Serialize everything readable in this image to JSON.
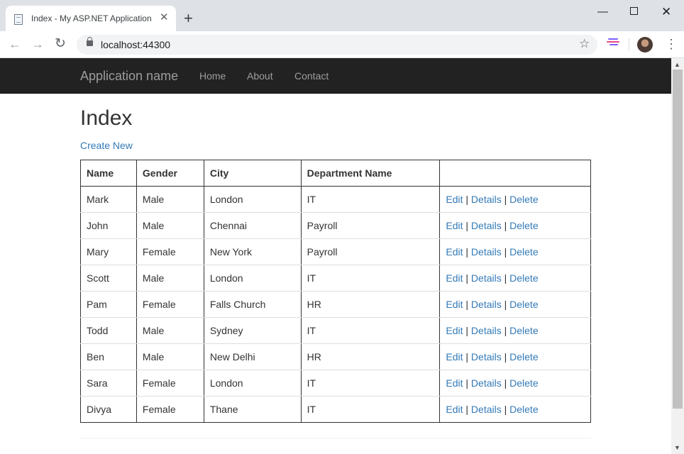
{
  "browser": {
    "tab_title": "Index - My ASP.NET Application",
    "url": "localhost:44300"
  },
  "site": {
    "brand": "Application name",
    "nav": {
      "home": "Home",
      "about": "About",
      "contact": "Contact"
    }
  },
  "page": {
    "title": "Index",
    "create_new": "Create New"
  },
  "table": {
    "headers": {
      "name": "Name",
      "gender": "Gender",
      "city": "City",
      "department": "Department Name"
    },
    "actions": {
      "edit": "Edit",
      "details": "Details",
      "delete": "Delete",
      "separator": "|"
    },
    "rows": [
      {
        "name": "Mark",
        "gender": "Male",
        "city": "London",
        "department": "IT"
      },
      {
        "name": "John",
        "gender": "Male",
        "city": "Chennai",
        "department": "Payroll"
      },
      {
        "name": "Mary",
        "gender": "Female",
        "city": "New York",
        "department": "Payroll"
      },
      {
        "name": "Scott",
        "gender": "Male",
        "city": "London",
        "department": "IT"
      },
      {
        "name": "Pam",
        "gender": "Female",
        "city": "Falls Church",
        "department": "HR"
      },
      {
        "name": "Todd",
        "gender": "Male",
        "city": "Sydney",
        "department": "IT"
      },
      {
        "name": "Ben",
        "gender": "Male",
        "city": "New Delhi",
        "department": "HR"
      },
      {
        "name": "Sara",
        "gender": "Female",
        "city": "London",
        "department": "IT"
      },
      {
        "name": "Divya",
        "gender": "Female",
        "city": "Thane",
        "department": "IT"
      }
    ]
  },
  "colors": {
    "navbar_bg": "#222222",
    "nav_text": "#9d9d9d",
    "link": "#337ab7",
    "text": "#333333"
  },
  "icons": {
    "favicon": "page-icon",
    "close": "close-icon",
    "new_tab": "plus-icon",
    "back": "arrow-left-icon",
    "forward": "arrow-right-icon",
    "reload": "reload-icon",
    "lock": "lock-icon",
    "bookmark": "star-icon",
    "extension": "extension-icon",
    "menu": "kebab-menu-icon"
  }
}
